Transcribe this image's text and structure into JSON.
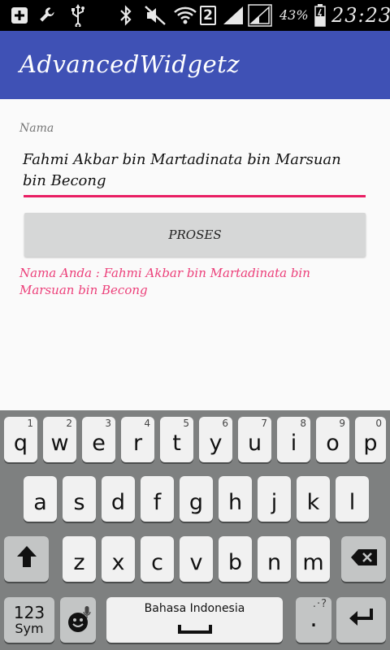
{
  "status_bar": {
    "sim_badge": "2",
    "battery_percent": "43%",
    "time": "23:23",
    "icons": [
      "add-box-icon",
      "wrench-icon",
      "usb-icon",
      "bluetooth-icon",
      "mute-icon",
      "wifi-icon",
      "sim-badge",
      "signal-icon",
      "signal-icon",
      "battery-charging-icon"
    ]
  },
  "app_bar": {
    "title": "AdvancedWidgetz",
    "color": "#3f51b5"
  },
  "form": {
    "label": "Nama",
    "input_value": "Fahmi Akbar bin Martadinata bin Marsuan bin Becong",
    "underline_color": "#e91e63",
    "button_label": "PROSES",
    "result_text": "Nama Anda : Fahmi Akbar bin Martadinata bin Marsuan bin Becong",
    "result_color": "#ec407a"
  },
  "keyboard": {
    "row1": [
      {
        "k": "q",
        "n": "1"
      },
      {
        "k": "w",
        "n": "2"
      },
      {
        "k": "e",
        "n": "3"
      },
      {
        "k": "r",
        "n": "4"
      },
      {
        "k": "t",
        "n": "5"
      },
      {
        "k": "y",
        "n": "6"
      },
      {
        "k": "u",
        "n": "7"
      },
      {
        "k": "i",
        "n": "8"
      },
      {
        "k": "o",
        "n": "9"
      },
      {
        "k": "p",
        "n": "0"
      }
    ],
    "row2": [
      "a",
      "s",
      "d",
      "f",
      "g",
      "h",
      "j",
      "k",
      "l"
    ],
    "row3": [
      "z",
      "x",
      "c",
      "v",
      "b",
      "n",
      "m"
    ],
    "sym_key": {
      "line1": "123",
      "line2": "Sym"
    },
    "space_label": "Bahasa Indonesia",
    "period_key": ".",
    "icons": [
      "shift-icon",
      "backspace-icon",
      "emoji-icon",
      "mic-icon",
      "space-bar-icon",
      "enter-icon"
    ]
  }
}
